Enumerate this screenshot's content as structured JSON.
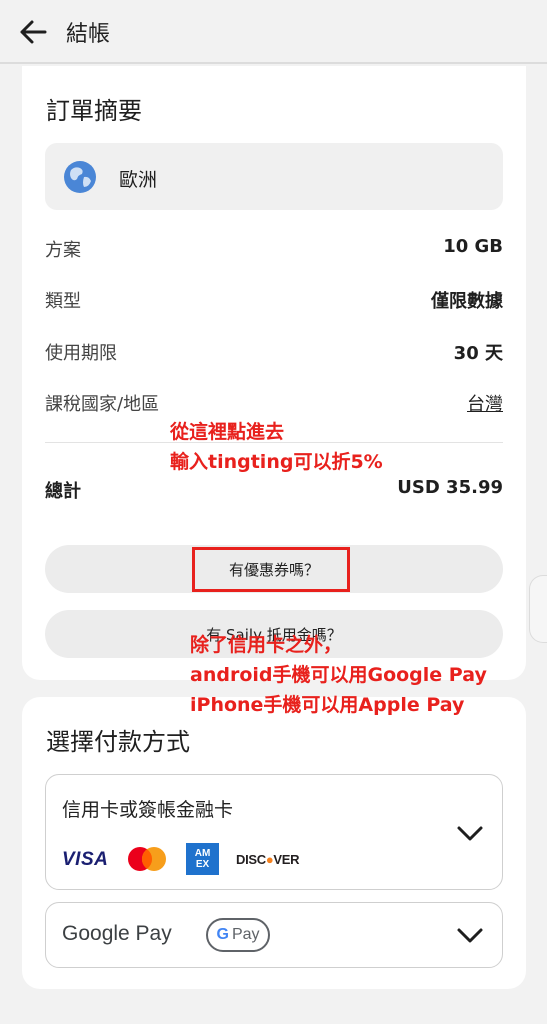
{
  "header": {
    "title": "結帳"
  },
  "summary": {
    "title": "訂單摘要",
    "region": "歐洲",
    "rows": [
      {
        "label": "方案",
        "value": "10 GB"
      },
      {
        "label": "類型",
        "value": "僅限數據"
      },
      {
        "label": "使用期限",
        "value": "30 天"
      },
      {
        "label": "課稅國家/地區",
        "value": "台灣"
      }
    ],
    "total_label": "總計",
    "total_value": "USD 35.99",
    "coupon_label": "有優惠券嗎？",
    "credit_label": "有 Saily 抵用金嗎？"
  },
  "annotations": {
    "coupon_line1": "從這裡點進去",
    "coupon_line2": "輸入tingting可以折5%",
    "pay_line1": "除了信用卡之外，",
    "pay_line2": "android手機可以用Google Pay",
    "pay_line3": "iPhone手機可以用Apple Pay",
    "highlight_color": "#e8211d"
  },
  "payment": {
    "title": "選擇付款方式",
    "card_option": "信用卡或簽帳金融卡",
    "card_brands": {
      "visa": "VISA",
      "amex_line1": "AM",
      "amex_line2": "EX",
      "discover_a": "DISC",
      "discover_b": "VER"
    },
    "gpay_option": "Google Pay",
    "gpay_badge": "Pay",
    "gpay_badge_g": "G"
  },
  "icons": [
    "back-arrow-icon",
    "globe-icon",
    "chevron-down-icon",
    "visa-logo",
    "mastercard-logo",
    "amex-logo",
    "discover-logo",
    "google-pay-badge"
  ]
}
